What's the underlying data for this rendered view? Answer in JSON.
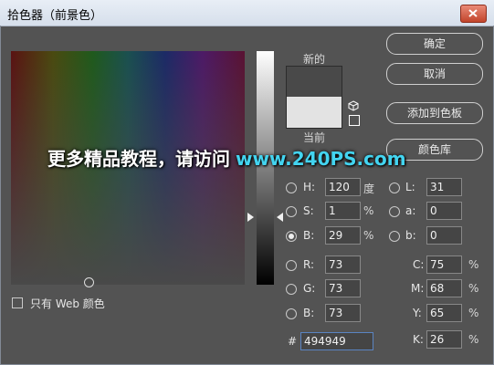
{
  "window": {
    "title": "拾色器（前景色）",
    "close_icon": "close-icon"
  },
  "preview": {
    "new_label": "新的",
    "current_label": "当前",
    "new_color": "#494949",
    "current_color": "#e3e3e3"
  },
  "buttons": {
    "ok": "确定",
    "cancel": "取消",
    "add_swatch": "添加到色板",
    "color_libraries": "颜色库"
  },
  "hsb": {
    "h": {
      "label": "H:",
      "value": "120",
      "unit": "度"
    },
    "s": {
      "label": "S:",
      "value": "1",
      "unit": "%"
    },
    "b": {
      "label": "B:",
      "value": "29",
      "unit": "%"
    }
  },
  "rgb": {
    "r": {
      "label": "R:",
      "value": "73"
    },
    "g": {
      "label": "G:",
      "value": "73"
    },
    "b": {
      "label": "B:",
      "value": "73"
    }
  },
  "lab": {
    "l": {
      "label": "L:",
      "value": "31"
    },
    "a": {
      "label": "a:",
      "value": "0"
    },
    "b": {
      "label": "b:",
      "value": "0"
    }
  },
  "cmyk": {
    "c": {
      "label": "C:",
      "value": "75",
      "unit": "%"
    },
    "m": {
      "label": "M:",
      "value": "68",
      "unit": "%"
    },
    "y": {
      "label": "Y:",
      "value": "65",
      "unit": "%"
    },
    "k": {
      "label": "K:",
      "value": "26",
      "unit": "%"
    }
  },
  "hex": {
    "label": "#",
    "value": "494949"
  },
  "web_only": {
    "label": "只有 Web 颜色",
    "checked": false
  },
  "selected_mode": "B",
  "watermark": {
    "text": "更多精品教程，请访问",
    "url": "www.240PS.com"
  }
}
